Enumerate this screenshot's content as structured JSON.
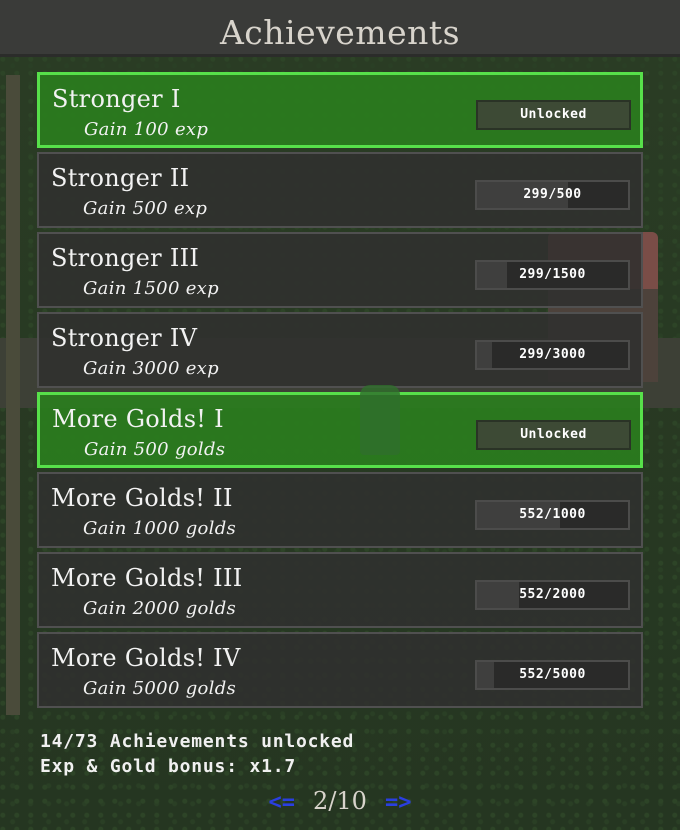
{
  "header": {
    "title": "Achievements"
  },
  "achievements": [
    {
      "name": "Stronger I",
      "desc": "Gain 100 exp",
      "status": "Unlocked",
      "unlocked": true,
      "progress": 1.0
    },
    {
      "name": "Stronger II",
      "desc": "Gain 500 exp",
      "status": "299/500",
      "unlocked": false,
      "progress": 0.598
    },
    {
      "name": "Stronger III",
      "desc": "Gain 1500 exp",
      "status": "299/1500",
      "unlocked": false,
      "progress": 0.199
    },
    {
      "name": "Stronger IV",
      "desc": "Gain 3000 exp",
      "status": "299/3000",
      "unlocked": false,
      "progress": 0.1
    },
    {
      "name": "More Golds! I",
      "desc": "Gain 500 golds",
      "status": "Unlocked",
      "unlocked": true,
      "progress": 1.0
    },
    {
      "name": "More Golds! II",
      "desc": "Gain 1000 golds",
      "status": "552/1000",
      "unlocked": false,
      "progress": 0.552
    },
    {
      "name": "More Golds! III",
      "desc": "Gain 2000 golds",
      "status": "552/2000",
      "unlocked": false,
      "progress": 0.276
    },
    {
      "name": "More Golds! IV",
      "desc": "Gain 5000 golds",
      "status": "552/5000",
      "unlocked": false,
      "progress": 0.11
    }
  ],
  "footer": {
    "unlocked_summary": "14/73 Achievements unlocked",
    "bonus": "Exp & Gold bonus: x1.7",
    "prev_label": "<=",
    "page": "2/10",
    "next_label": "=>"
  },
  "colors": {
    "unlocked_bg": "#2a801e",
    "unlocked_border": "#57e04a",
    "locked_bg": "#30302f",
    "pager_arrow": "#2a3fe0"
  }
}
